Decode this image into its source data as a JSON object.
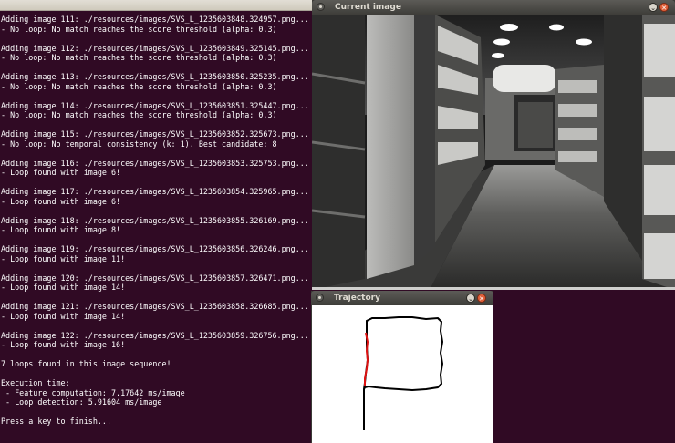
{
  "terminal": {
    "lines": [
      "Adding image 111: ./resources/images/SVS_L_1235603848.324957.png...",
      "- No loop: No match reaches the score threshold (alpha: 0.3)",
      "",
      "Adding image 112: ./resources/images/SVS_L_1235603849.325145.png...",
      "- No loop: No match reaches the score threshold (alpha: 0.3)",
      "",
      "Adding image 113: ./resources/images/SVS_L_1235603850.325235.png...",
      "- No loop: No match reaches the score threshold (alpha: 0.3)",
      "",
      "Adding image 114: ./resources/images/SVS_L_1235603851.325447.png...",
      "- No loop: No match reaches the score threshold (alpha: 0.3)",
      "",
      "Adding image 115: ./resources/images/SVS_L_1235603852.325673.png...",
      "- No loop: No temporal consistency (k: 1). Best candidate: 8",
      "",
      "Adding image 116: ./resources/images/SVS_L_1235603853.325753.png...",
      "- Loop found with image 6!",
      "",
      "Adding image 117: ./resources/images/SVS_L_1235603854.325965.png...",
      "- Loop found with image 6!",
      "",
      "Adding image 118: ./resources/images/SVS_L_1235603855.326169.png...",
      "- Loop found with image 8!",
      "",
      "Adding image 119: ./resources/images/SVS_L_1235603856.326246.png...",
      "- Loop found with image 11!",
      "",
      "Adding image 120: ./resources/images/SVS_L_1235603857.326471.png...",
      "- Loop found with image 14!",
      "",
      "Adding image 121: ./resources/images/SVS_L_1235603858.326685.png...",
      "- Loop found with image 14!",
      "",
      "Adding image 122: ./resources/images/SVS_L_1235603859.326756.png...",
      "- Loop found with image 16!",
      "",
      "7 loops found in this image sequence!",
      "",
      "Execution time:",
      " - Feature computation: 7.17642 ms/image",
      " - Loop detection: 5.91604 ms/image",
      "",
      "Press a key to finish..."
    ]
  },
  "current_image_window": {
    "title": "Current image",
    "icons": {
      "menu": "window-menu-icon",
      "minimize": "minimize-icon",
      "close": "close-icon"
    },
    "min_glyph": "⌄",
    "close_glyph": "✕"
  },
  "trajectory_window": {
    "title": "Trajectory",
    "icons": {
      "menu": "window-menu-icon",
      "minimize": "minimize-icon",
      "close": "close-icon"
    },
    "min_glyph": "⌄",
    "close_glyph": "✕",
    "path_color": "#000000",
    "loop_highlight_color": "#dd1111"
  }
}
